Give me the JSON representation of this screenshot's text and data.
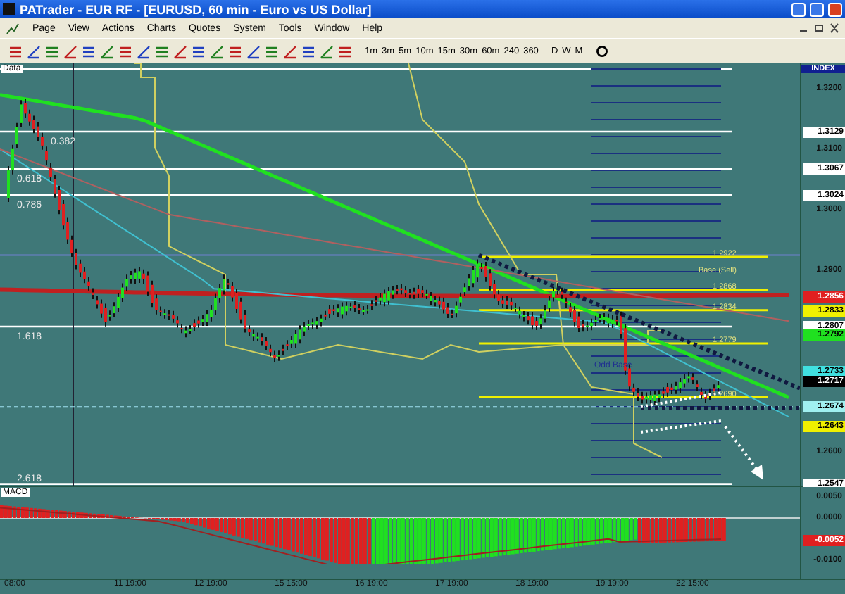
{
  "window": {
    "title": "PATrader - EUR RF - [EURUSD, 60 min - Euro vs US Dollar]"
  },
  "menu": [
    "Page",
    "View",
    "Actions",
    "Charts",
    "Quotes",
    "System",
    "Tools",
    "Window",
    "Help"
  ],
  "toolbar": {
    "timeframes": [
      "1m",
      "3m",
      "5m",
      "10m",
      "15m",
      "30m",
      "60m",
      "240",
      "360",
      "D",
      "W",
      "M"
    ]
  },
  "chart": {
    "panel_label": "Data",
    "index_label": "INDEX",
    "fib_labels": [
      "0.382",
      "0.618",
      "0.786",
      "1.618",
      "2.618"
    ],
    "axis_ticks": [
      "1.3200",
      "1.3100",
      "1.3000",
      "1.2900",
      "1.2600"
    ],
    "price_tags": [
      {
        "text": "1.3129",
        "color": "#ffffff"
      },
      {
        "text": "1.3067",
        "color": "#ffffff"
      },
      {
        "text": "1.3024",
        "color": "#ffffff"
      },
      {
        "text": "1.2856",
        "color": "#e02020"
      },
      {
        "text": "1.2833",
        "color": "#f0f000"
      },
      {
        "text": "1.2807",
        "color": "#ffffff"
      },
      {
        "text": "1.2792",
        "color": "#20e020"
      },
      {
        "text": "1.2733",
        "color": "#40e0e0"
      },
      {
        "text": "1.2717",
        "color": "#000000"
      },
      {
        "text": "1.2674",
        "color": "#a0f0f0"
      },
      {
        "text": "1.2643",
        "color": "#f0f000"
      },
      {
        "text": "1.2547",
        "color": "#ffffff"
      }
    ],
    "level_labels": [
      "1.2922",
      "Base (Sell)",
      "1.2868",
      "1.2834",
      "1.2779",
      "1.2690"
    ],
    "zone_label": "Odd Base"
  },
  "macd": {
    "label": "MACD",
    "axis_ticks": [
      "0.0050",
      "0.0000",
      "-0.0100"
    ],
    "value_tag": {
      "text": "-0.0052",
      "color": "#e02020"
    }
  },
  "time_axis": [
    "08:00",
    "11 19:00",
    "12 19:00",
    "15 15:00",
    "16 19:00",
    "17 19:00",
    "18 19:00",
    "19 19:00",
    "22 15:00"
  ]
}
